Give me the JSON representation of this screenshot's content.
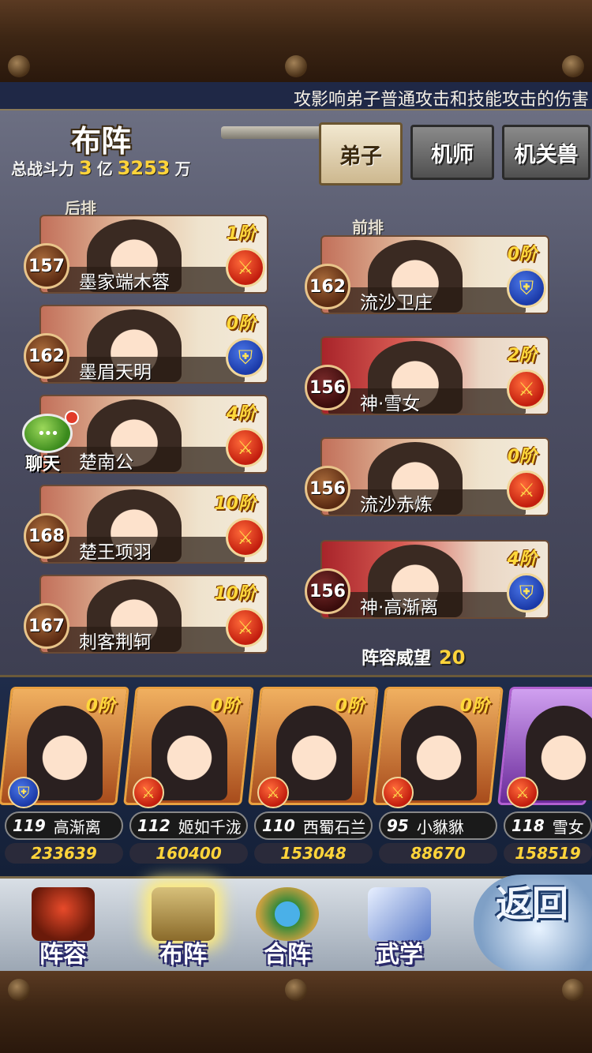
{
  "ticker": "攻影响弟子普通攻击和技能攻击的伤害",
  "header": {
    "title": "布阵",
    "power_label": "总战斗力",
    "power_yi": "3",
    "power_yi_unit": "亿",
    "power_wan": "3253",
    "power_wan_unit": "万"
  },
  "tabs": [
    {
      "label": "弟子"
    },
    {
      "label": "机师"
    },
    {
      "label": "机关兽"
    }
  ],
  "back_row_label": "后排",
  "front_row_label": "前排",
  "back_row": [
    {
      "level": "157",
      "name": "墨家端木蓉",
      "rank": "1阶",
      "role": "attack"
    },
    {
      "level": "162",
      "name": "墨眉天明",
      "rank": "0阶",
      "role": "defense"
    },
    {
      "level": "",
      "name": "楚南公",
      "rank": "4阶",
      "role": "attack"
    },
    {
      "level": "168",
      "name": "楚王项羽",
      "rank": "10阶",
      "role": "attack"
    },
    {
      "level": "167",
      "name": "刺客荆轲",
      "rank": "10阶",
      "role": "attack"
    }
  ],
  "front_row": [
    {
      "level": "162",
      "name": "流沙卫庄",
      "rank": "0阶",
      "role": "defense"
    },
    {
      "level": "156",
      "name": "神·雪女",
      "rank": "2阶",
      "role": "attack"
    },
    {
      "level": "156",
      "name": "流沙赤炼",
      "rank": "0阶",
      "role": "attack"
    },
    {
      "level": "156",
      "name": "神·高渐离",
      "rank": "4阶",
      "role": "defense"
    }
  ],
  "chat": {
    "label": "聊天"
  },
  "prestige": {
    "label": "阵容威望",
    "value": "20"
  },
  "roster": [
    {
      "level": "119",
      "name": "高渐离",
      "power": "233639",
      "rank": "0阶",
      "role": "defense"
    },
    {
      "level": "112",
      "name": "姬如千泷",
      "power": "160400",
      "rank": "0阶",
      "role": "attack"
    },
    {
      "level": "110",
      "name": "西蜀石兰",
      "power": "153048",
      "rank": "0阶",
      "role": "attack"
    },
    {
      "level": "95",
      "name": "小貅貅",
      "power": "88670",
      "rank": "0阶",
      "role": "attack"
    },
    {
      "level": "118",
      "name": "雪女",
      "power": "158519",
      "rank": "",
      "role": "attack"
    }
  ],
  "nav": [
    {
      "label": "阵容"
    },
    {
      "label": "布阵"
    },
    {
      "label": "合阵"
    },
    {
      "label": "武学"
    }
  ],
  "back_button": "返回",
  "colors": {
    "gold": "#ffd43a",
    "attack": "#c21d0e",
    "defense": "#1b3aa8"
  }
}
